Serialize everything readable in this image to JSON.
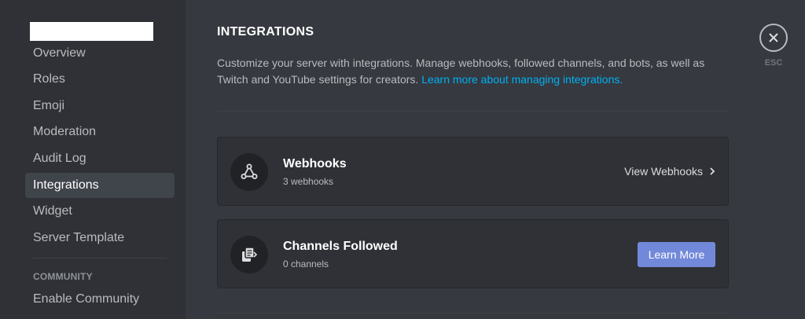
{
  "sidebar": {
    "items": [
      {
        "label": "Overview"
      },
      {
        "label": "Roles"
      },
      {
        "label": "Emoji"
      },
      {
        "label": "Moderation"
      },
      {
        "label": "Audit Log"
      },
      {
        "label": "Integrations",
        "active": true
      },
      {
        "label": "Widget"
      },
      {
        "label": "Server Template"
      }
    ],
    "section_header": "COMMUNITY",
    "section_items": [
      {
        "label": "Enable Community"
      }
    ]
  },
  "main": {
    "title": "INTEGRATIONS",
    "description": "Customize your server with integrations. Manage webhooks, followed channels, and bots, as well as Twitch and YouTube settings for creators.",
    "learn_more_link": "Learn more about managing integrations.",
    "cards": [
      {
        "title": "Webhooks",
        "subtitle": "3 webhooks",
        "action": "View Webhooks",
        "icon": "webhook-icon"
      },
      {
        "title": "Channels Followed",
        "subtitle": "0 channels",
        "action": "Learn More",
        "icon": "channel-follow-icon"
      }
    ]
  },
  "close": {
    "label": "ESC"
  },
  "colors": {
    "accent": "#7289da",
    "link": "#00b0f4",
    "background": "#36393f",
    "sidebar": "#2f3136"
  }
}
